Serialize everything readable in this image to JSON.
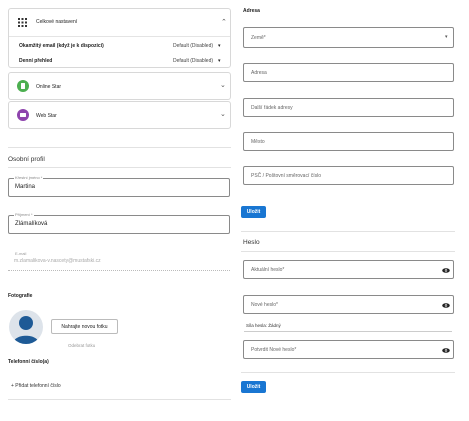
{
  "left": {
    "accordion": {
      "general": {
        "title": "Celkové nastavení",
        "rows": [
          {
            "label": "Okamžitý email (když je k dispozici)",
            "value": "Default (Disabled)"
          },
          {
            "label": "Denní přehled",
            "value": "Default (Disabled)"
          }
        ]
      },
      "online": {
        "title": "Online Star"
      },
      "web": {
        "title": "Web Star"
      }
    },
    "profile": {
      "heading": "Osobní profil",
      "first_name": {
        "label": "Křestní jméno *",
        "value": "Martina"
      },
      "last_name": {
        "label": "Příjmení *",
        "value": "Zlámalíková"
      },
      "email": {
        "label": "E-mail",
        "value": "m.zlamalikova-v.nascety@mustafski.cz"
      }
    },
    "photo": {
      "heading": "Fotografie",
      "upload_label": "Nahrajte novou fotku",
      "remove_label": "Odebrat fotku"
    },
    "phones": {
      "heading": "Telefonní číslo(a)",
      "add_label": "+ Přidat telefonní číslo"
    }
  },
  "right": {
    "address": {
      "heading": "Adresa",
      "country_placeholder": "Země*",
      "address_placeholder": "Adresa",
      "address2_placeholder": "Další řádek adresy",
      "city_placeholder": "Město",
      "zip_placeholder": "PSČ / Poštovní směrovací číslo",
      "save_label": "Uložit"
    },
    "password": {
      "heading": "Heslo",
      "current_placeholder": "Aktuální heslo*",
      "new_placeholder": "Nové heslo*",
      "strength_label": "Síla hesla: Žádný",
      "confirm_placeholder": "Potvrdit Nové heslo*",
      "save_label": "Uložit"
    }
  },
  "colors": {
    "primary": "#1976d2",
    "online_icon": "#4caf50",
    "web_icon": "#8e44ad"
  }
}
